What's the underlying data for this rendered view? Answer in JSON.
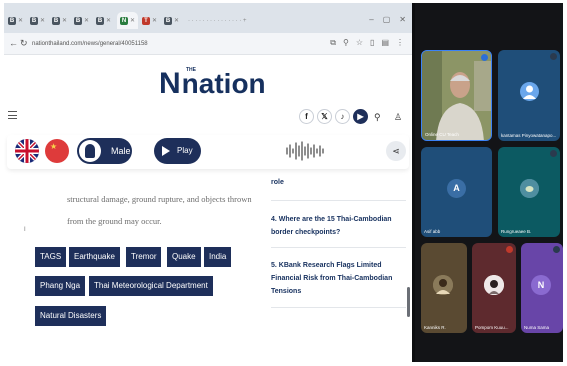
{
  "colors": {
    "brand_navy": "#1e2f5a",
    "brand_text": "#16305e",
    "meeting_bg": "#131417",
    "tile_blue": "#1f4e79",
    "tile_teal": "#0c5a62",
    "tile_purple": "#6845a8"
  },
  "browser": {
    "tabs": [
      {
        "icon": "tab-favicon",
        "letter": "B"
      },
      {
        "icon": "tab-favicon",
        "letter": "B"
      },
      {
        "icon": "tab-favicon",
        "letter": "B"
      },
      {
        "icon": "tab-favicon",
        "letter": "B"
      },
      {
        "icon": "tab-favicon",
        "letter": "B"
      },
      {
        "icon": "tab-favicon",
        "letter": "N"
      },
      {
        "icon": "tab-favicon",
        "letter": "T"
      },
      {
        "icon": "tab-favicon",
        "letter": "B"
      }
    ],
    "url": "nationthailand.com/news/general/40051158"
  },
  "site": {
    "logo_small": "THE",
    "logo_word": "nation",
    "social": [
      {
        "icon": "facebook-icon",
        "glyph": "f"
      },
      {
        "icon": "x-icon",
        "glyph": "𝕏"
      },
      {
        "icon": "tiktok-icon",
        "glyph": "♪"
      },
      {
        "icon": "youtube-icon",
        "glyph": "▶"
      }
    ]
  },
  "player": {
    "voice_label": "Male",
    "play_label": "Play"
  },
  "article": {
    "text": "structural damage, ground rupture, and objects thrown from the ground may occur.",
    "cursor": "I",
    "tags_label": "TAGS",
    "tags": [
      "Earthquake",
      "Tremor",
      "Quake",
      "India",
      "Phang Nga",
      "Thai Meteorological Department",
      "Natural Disasters"
    ]
  },
  "related": {
    "tail": "role",
    "items": [
      "4. Where are the 15 Thai-Cambodian border checkpoints?",
      "5. KBank Research Flags Limited Financial Risk from Thai-Cambodian Tensions"
    ]
  },
  "meeting": {
    "participants": [
      {
        "name": "Online CU Teach",
        "initial": "",
        "type": "video"
      },
      {
        "name": "kantamas Pinyowatanapo...",
        "initial": "",
        "type": "avatar-generic"
      },
      {
        "name": "Asif abb",
        "initial": "A",
        "type": "letter"
      },
      {
        "name": "Rungrueaee B.",
        "initial": "",
        "type": "photo"
      },
      {
        "name": "Kanniks R.",
        "initial": "",
        "type": "photo"
      },
      {
        "name": "Pompom Kuuu...",
        "initial": "",
        "type": "photo"
      },
      {
        "name": "Numa Sama",
        "initial": "N",
        "type": "letter"
      }
    ]
  }
}
